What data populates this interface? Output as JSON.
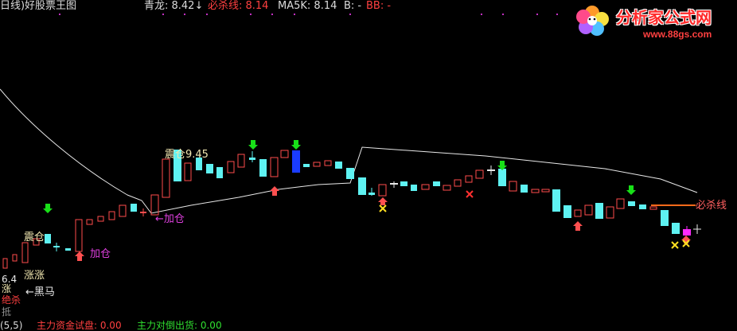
{
  "header": {
    "period_label": "日线)",
    "window_title": "好股票王图",
    "qinglong_label": "青龙: 8.42",
    "qinglong_arrow": "↓",
    "bishaxian_label": "必杀线: 8.14",
    "ma5k_label": "MA5K: 8.14",
    "b_label": "B: -",
    "bb_label": "BB: -"
  },
  "logo": {
    "name": "分析家公式网",
    "url": "www.88gs.com"
  },
  "annotations": {
    "zhencang_top": "震仓9.45",
    "jiacang_mid": "←加仓",
    "zhencang_left": "震仓",
    "jiacang_low": "加仓",
    "zhangzhang": "涨涨",
    "heima": "←黑马",
    "bishaxian_right": "必杀线",
    "left_value": "6.4",
    "left_ju": "绝杀",
    "left_ding": "涨",
    "left_bottom": "抵"
  },
  "footer": {
    "period_code": "(5,5)",
    "label1": "主力资金试盘: 0.00",
    "label2": "主力对倒出货: 0.00"
  },
  "colors": {
    "bg": "#000000",
    "up_candle": "#ff4d4d",
    "down_candle": "#5ef2f2",
    "highlight_candle": "#1a3cff",
    "magenta_candle": "#ff2aff",
    "bishaxian_line": "#ff6a1a",
    "ma_line": "#e8e8e8",
    "green_arrow": "#18e018",
    "red_arrow": "#ff5050",
    "yellow_x": "#ffe020",
    "text_white": "#dcdcdc",
    "text_red": "#ff4040",
    "text_magenta": "#e040e0",
    "text_yellow": "#f0e060"
  },
  "icons": [
    "green-down-arrow-icon",
    "red-up-arrow-icon",
    "yellow-x-icon",
    "red-x-icon",
    "flower-logo-icon"
  ]
}
